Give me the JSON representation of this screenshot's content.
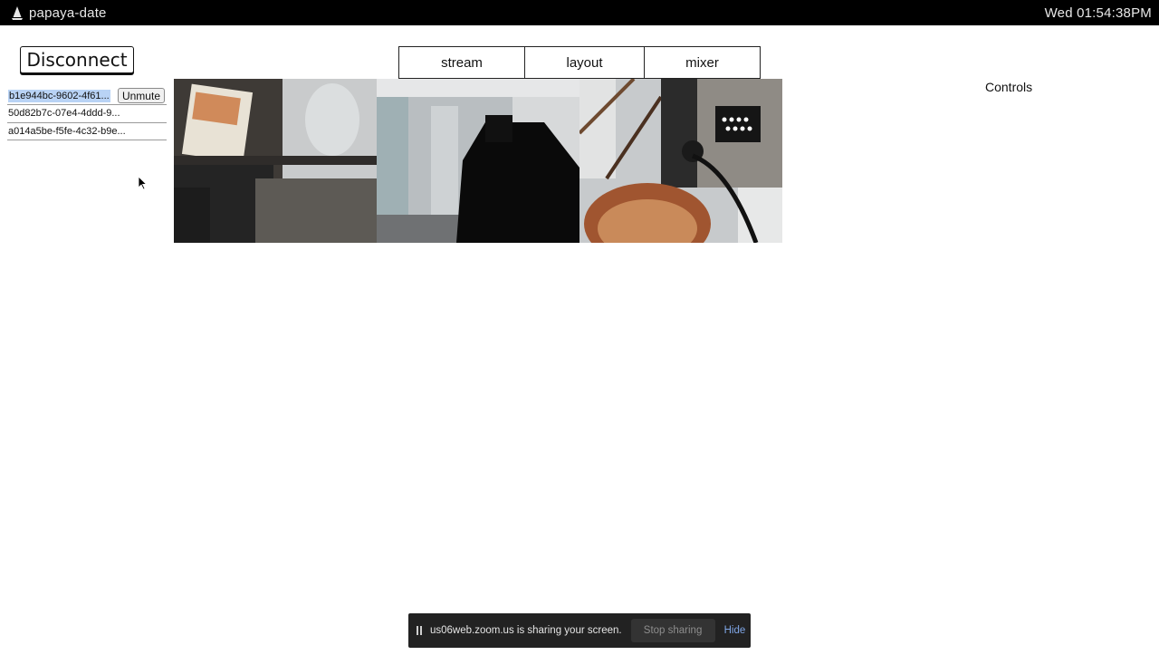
{
  "system": {
    "app_title": "papaya-date",
    "clock": "Wed 01:54:38PM"
  },
  "toolbar": {
    "disconnect_label": "Disconnect"
  },
  "tabs": [
    {
      "label": "stream"
    },
    {
      "label": "layout"
    },
    {
      "label": "mixer"
    }
  ],
  "peers": [
    {
      "id": "b1e944bc-9602-4f61...",
      "selected": true,
      "action_label": "Unmute"
    },
    {
      "id": "50d82b7c-07e4-4ddd-9..."
    },
    {
      "id": "a014a5be-f5fe-4c32-b9e..."
    }
  ],
  "controls": {
    "title": "Controls"
  },
  "share_bar": {
    "message": "us06web.zoom.us is sharing your screen.",
    "stop_label": "Stop sharing",
    "hide_label": "Hide"
  },
  "colors": {
    "selection": "#b9d3f5",
    "share_bar_bg": "#222222",
    "hide_link": "#7fa6e6"
  },
  "icons": {
    "app_logo": "papaya-logo-icon",
    "cursor": "mouse-pointer-icon",
    "pause": "pause-icon"
  }
}
